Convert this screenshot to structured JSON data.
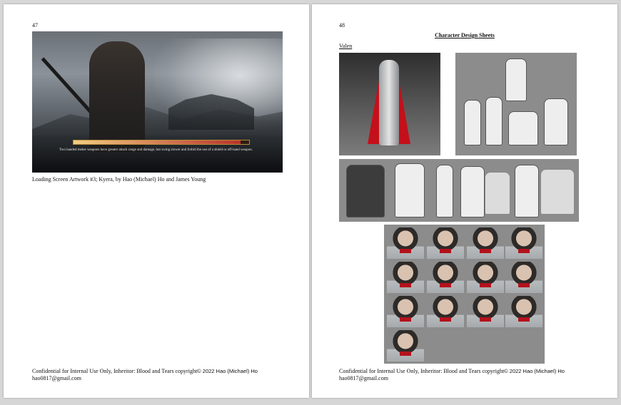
{
  "left_page": {
    "page_number": "47",
    "artwork": {
      "tip_text": "Two handed melee weapons have greater attack range and damage, but swing slower and forbid the use of a shield or off-hand weapon.",
      "loading_progress": 0.95
    },
    "caption": "Loading Screen Artwork #3; Kyera, by Hao (Michael) Ho and James Young",
    "footer": {
      "line1_prefix": "Confidential for Internal Use Only, Inheritor: Blood and Tears copyright",
      "line1_suffix": "© 2022 Hao (Michael) Ho",
      "line2": "hao0817@gmail.com"
    }
  },
  "right_page": {
    "page_number": "48",
    "title": "Character Design Sheets",
    "character_name": "Valen",
    "footer": {
      "line1_prefix": "Confidential for Internal Use Only, Inheritor: Blood and Tears copyright",
      "line1_suffix": "© 2022 Hao (Michael) Ho",
      "line2": "hao0817@gmail.com"
    }
  },
  "colors": {
    "cape_red": "#c4101a",
    "sheet_gray": "#8c8c8c",
    "page_bg": "#ffffff",
    "viewer_bg": "#d6d6d6"
  }
}
